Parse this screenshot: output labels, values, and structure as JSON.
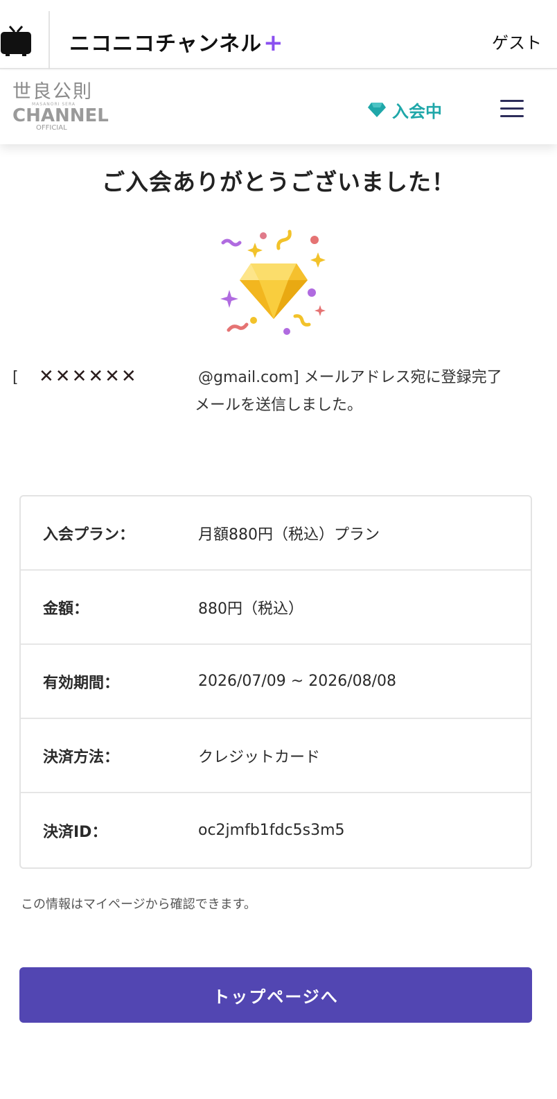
{
  "topbar": {
    "brand_text": "ニコニコチャンネル",
    "brand_plus": "+",
    "guest_label": "ゲスト"
  },
  "channel": {
    "logo_kanji": "世良公則",
    "logo_small": "MASANORI SERA",
    "logo_channel": "CHANNEL",
    "logo_official": "OFFICIAL",
    "member_label": "入会中"
  },
  "main": {
    "title": "ご入会ありがとうございました！",
    "mail_open": "[",
    "mail_masked": "✕✕✕✕✕✕",
    "mail_rest": "@gmail.com] メールアドレス宛に登録完了",
    "mail_line2": "メールを送信しました。",
    "rows": [
      {
        "label": "入会プラン：",
        "value": "月額880円（税込）プラン"
      },
      {
        "label": "金額：",
        "value": "880円（税込）"
      },
      {
        "label": "有効期間：",
        "value": "2026/07/09 ~ 2026/08/08"
      },
      {
        "label": "決済方法：",
        "value": "クレジットカード"
      },
      {
        "label": "決済ID：",
        "value": "oc2jmfb1fdc5s3m5"
      }
    ],
    "note": "この情報はマイページから確認できます。",
    "button_label": "トップページへ"
  },
  "colors": {
    "button_bg": "#5246b2",
    "member_teal": "#1fa7a9",
    "brand_plus": "#8a4ff0",
    "diamond": "#f7c531"
  }
}
